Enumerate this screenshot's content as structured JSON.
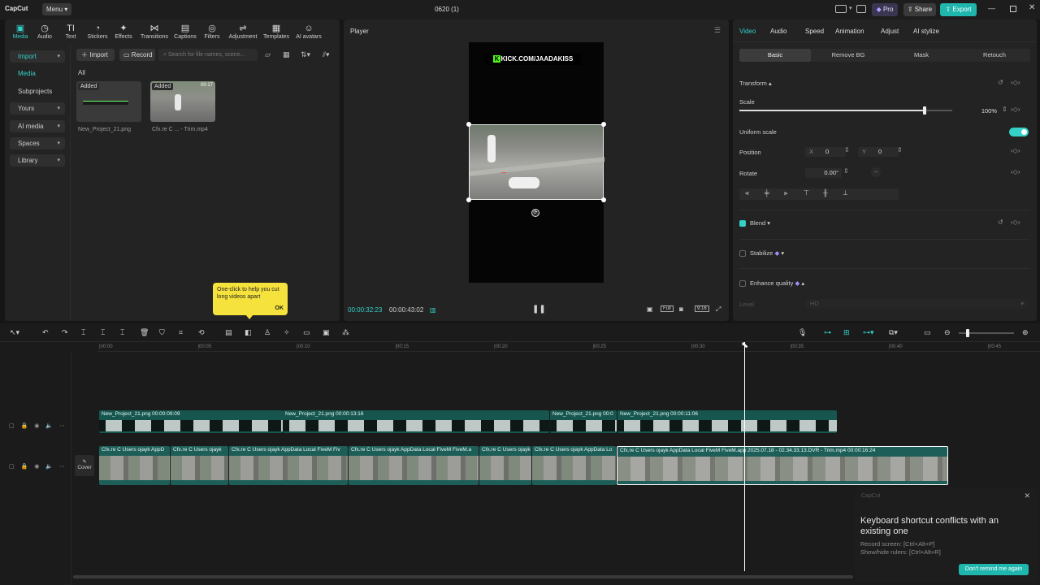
{
  "app": {
    "logo": "CapCut",
    "menu_label": "Menu",
    "project_title": "0620 (1)",
    "pro_label": "Pro",
    "share_label": "Share",
    "export_label": "Export",
    "accent": "#35d0c8"
  },
  "media_tabs": [
    {
      "label": "Media",
      "icon": "▣"
    },
    {
      "label": "Audio",
      "icon": "◷"
    },
    {
      "label": "Text",
      "icon": "TI"
    },
    {
      "label": "Stickers",
      "icon": "◔"
    },
    {
      "label": "Effects",
      "icon": "✦"
    },
    {
      "label": "Transitions",
      "icon": "⋈"
    },
    {
      "label": "Captions",
      "icon": "▤"
    },
    {
      "label": "Filters",
      "icon": "◎"
    },
    {
      "label": "Adjustment",
      "icon": "⇌"
    },
    {
      "label": "Templates",
      "icon": "▦"
    },
    {
      "label": "AI avatars",
      "icon": "☺"
    }
  ],
  "media_sidebar": {
    "import": "Import",
    "media": "Media",
    "subprojects": "Subprojects",
    "yours": "Yours",
    "ai_media": "AI media",
    "spaces": "Spaces",
    "library": "Library"
  },
  "media_toolbar": {
    "import": "Import",
    "record": "Record",
    "search_placeholder": "Search for file names, scene...",
    "filter_all": "All"
  },
  "media_items": [
    {
      "badge": "Added",
      "name": "New_Project_21.png"
    },
    {
      "badge": "Added",
      "name": "Cfx.re  C ... - Trim.mp4",
      "duration": "00:17"
    }
  ],
  "tooltip": {
    "text": "One-click to help you cut long videos apart",
    "ok": "OK"
  },
  "player": {
    "title": "Player",
    "overlay_text": "KICK.COM/JAADAKISS",
    "current_time": "00:00:32:23",
    "total_time": "00:00:43:02",
    "full_label": "Full",
    "ratio_label": "9:16"
  },
  "props": {
    "tabs": [
      "Video",
      "Audio",
      "Speed",
      "Animation",
      "Adjust",
      "AI stylize"
    ],
    "subtabs": [
      "Basic",
      "Remove BG",
      "Mask",
      "Retouch"
    ],
    "transform": "Transform",
    "scale": "Scale",
    "scale_value": "100%",
    "scale_fraction": 0.87,
    "uniform_scale": "Uniform scale",
    "position": "Position",
    "x_label": "X",
    "x_value": "0",
    "y_label": "Y",
    "y_value": "0",
    "rotate": "Rotate",
    "rotate_value": "0.00°",
    "blend": "Blend",
    "stabilize": "Stabilize",
    "enhance_quality": "Enhance quality",
    "level": "Level",
    "level_value": "HD"
  },
  "timeline": {
    "ruler": [
      "00:00",
      "00:05",
      "00:10",
      "00:15",
      "00:20",
      "00:25",
      "00:30",
      "00:35",
      "00:40",
      "00:45"
    ],
    "cover_label": "Cover",
    "overlay_clips": [
      {
        "label": "New_Project_21.png   00:00:09:09"
      },
      {
        "label": "New_Project_21.png   00:00:13:16"
      },
      {
        "label": "New_Project_21.png   00:0"
      },
      {
        "label": "New_Project_21.png   00:00:11:06"
      }
    ],
    "video_clips": [
      {
        "label": "Cfx.re  C  Users ojayk AppD"
      },
      {
        "label": "Cfx.re  C  Users ojayk"
      },
      {
        "label": "Cfx.re  C  Users ojayk AppData Local FiveM Fiv"
      },
      {
        "label": "Cfx.re  C  Users ojayk AppData Local FiveM FiveM.a"
      },
      {
        "label": "Cfx.re  C  Users ojayk"
      },
      {
        "label": "Cfx.re  C  Users ojayk AppData Lo"
      },
      {
        "label": "Cfx.re  C  Users ojayk AppData Local FiveM FiveM.app 2025.07.18 - 02.34.33.13.DVR - Trim.mp4   00:00:16:24"
      }
    ]
  },
  "notification": {
    "app": "CapCut",
    "title": "Keyboard shortcut conflicts with an existing one",
    "line1": "Record screen: [Ctrl+Alt+P]",
    "line2": "Show/hide rulers: [Ctrl+Alt+R]",
    "button": "Don't remind me again"
  }
}
